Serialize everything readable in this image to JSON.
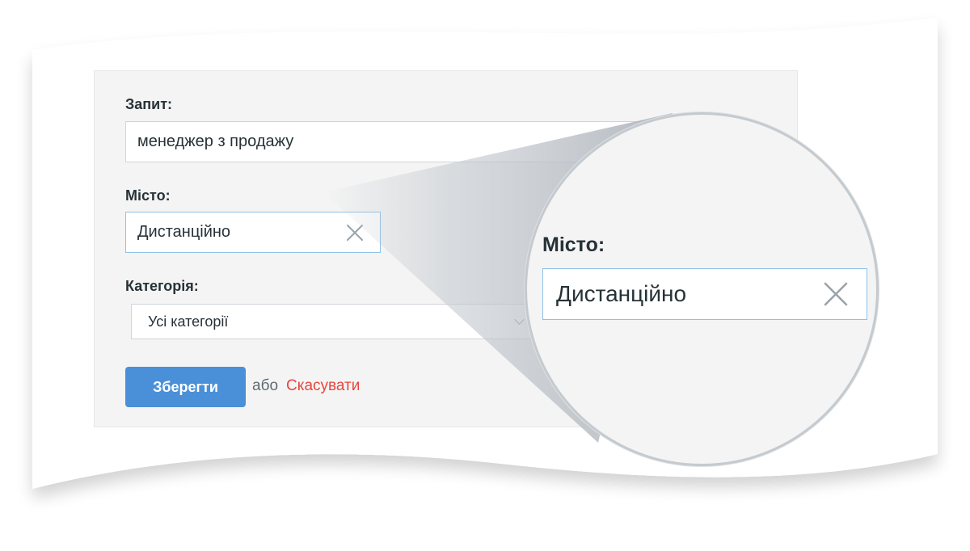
{
  "form": {
    "query": {
      "label": "Запит:",
      "value": "менеджер з продажу"
    },
    "city": {
      "label": "Місто:",
      "value": "Дистанційно"
    },
    "category": {
      "label": "Категорія:",
      "selected": "Усі категорії"
    },
    "actions": {
      "save_label": "Зберегти",
      "or_text": "або",
      "cancel_label": "Скасувати"
    }
  },
  "magnifier": {
    "label": "Місто:",
    "value": "Дистанційно"
  },
  "colors": {
    "primary_button": "#4a90d9",
    "cancel_link": "#e8453c",
    "panel_background": "#f4f4f4",
    "focus_border": "#8fc0e6"
  },
  "icons": {
    "clear": "close-icon",
    "dropdown": "chevron-down-icon"
  }
}
